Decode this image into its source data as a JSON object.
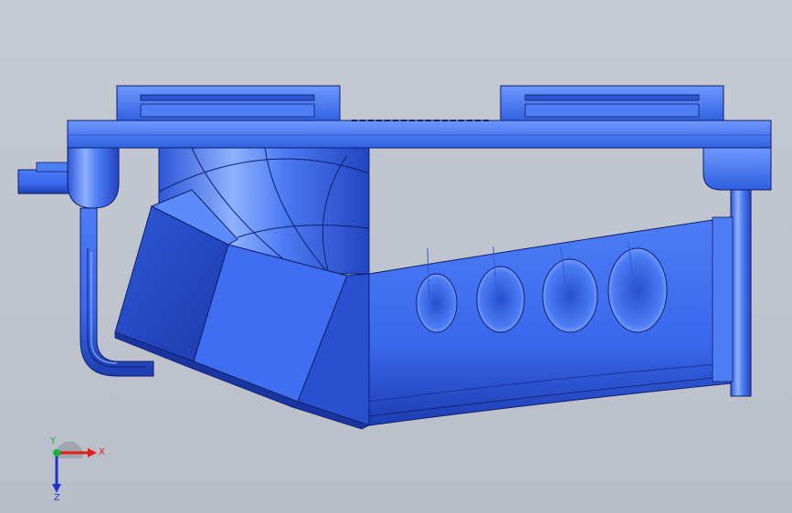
{
  "viewport": {
    "background_top": "#c6cad3",
    "background_bottom": "#b9bec8"
  },
  "model": {
    "part_color": "#3a6ff0",
    "part_shadow": "#2546b8",
    "edge_color": "#0e1f6b",
    "sketch_line_color": "#2f5cd6"
  },
  "triad": {
    "x_label": "X",
    "y_label": "Y",
    "z_label": "Z",
    "x_color": "#e21b1b",
    "y_color": "#18b43a",
    "z_color": "#2233cc"
  }
}
